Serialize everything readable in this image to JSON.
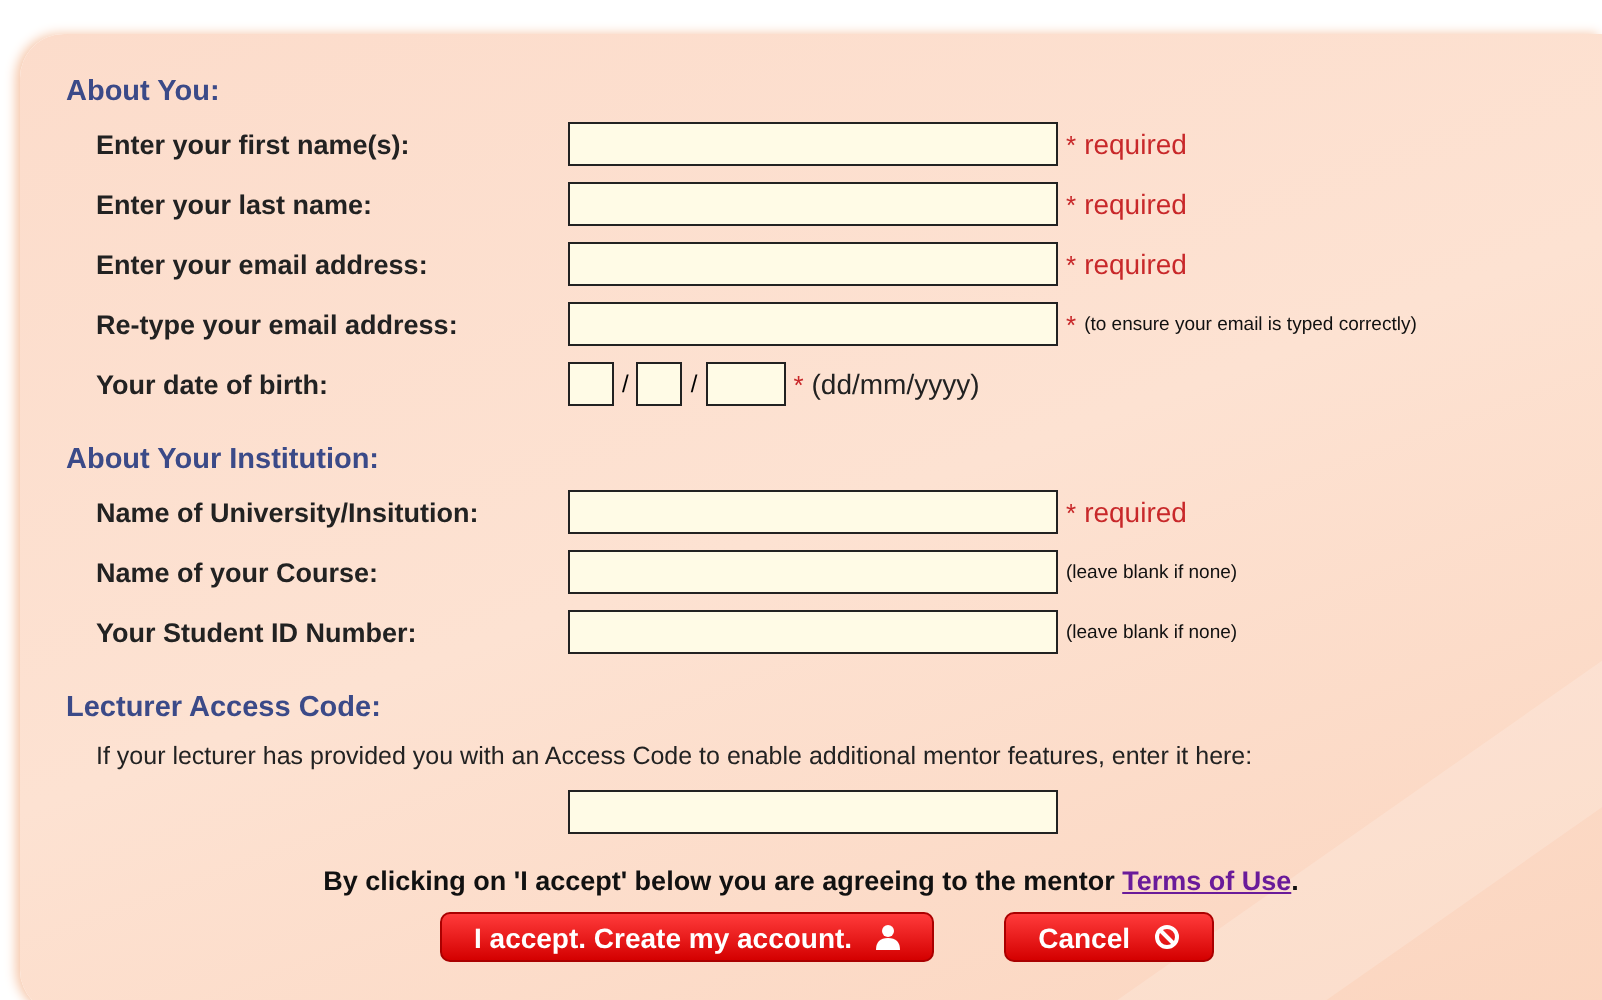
{
  "sections": [
    {
      "title": "About You:",
      "fields": [
        {
          "kind": "text",
          "label": "Enter your first name(s):",
          "mark": "*",
          "note": {
            "kind": "required",
            "text": "required"
          }
        },
        {
          "kind": "text",
          "label": "Enter your last name:",
          "mark": "*",
          "note": {
            "kind": "required",
            "text": "required"
          }
        },
        {
          "kind": "text",
          "label": "Enter your email address:",
          "mark": "*",
          "note": {
            "kind": "required",
            "text": "required"
          }
        },
        {
          "kind": "text",
          "label": "Re-type your email address:",
          "mark": "*",
          "note": {
            "kind": "hint",
            "text": "(to ensure your email is typed correctly)"
          }
        },
        {
          "kind": "date",
          "label": "Your date of birth:",
          "separators": [
            "/",
            "/"
          ],
          "mark": "*",
          "note": {
            "kind": "format",
            "text": "(dd/mm/yyyy)"
          }
        }
      ]
    },
    {
      "title": "About Your Institution:",
      "fields": [
        {
          "kind": "text",
          "label": "Name of University/Insitution:",
          "mark": "*",
          "note": {
            "kind": "required",
            "text": "required"
          }
        },
        {
          "kind": "text",
          "label": "Name of your Course:",
          "note": {
            "kind": "hint",
            "text": "(leave blank if none)"
          }
        },
        {
          "kind": "text",
          "label": "Your Student ID Number:",
          "note": {
            "kind": "hint",
            "text": "(leave blank if none)"
          }
        }
      ]
    },
    {
      "title": "Lecturer Access Code:",
      "intro": "If your lecturer has provided you with an Access Code to enable additional mentor features, enter it here:",
      "fields": [
        {
          "kind": "centered"
        }
      ]
    }
  ],
  "agreement": {
    "text": "By clicking on 'I accept' below you are agreeing to the mentor",
    "link": "Terms of Use",
    "end": "."
  },
  "buttons": [
    {
      "kind": "accept",
      "label": "I accept.  Create my account."
    },
    {
      "kind": "cancel",
      "label": "Cancel"
    }
  ]
}
